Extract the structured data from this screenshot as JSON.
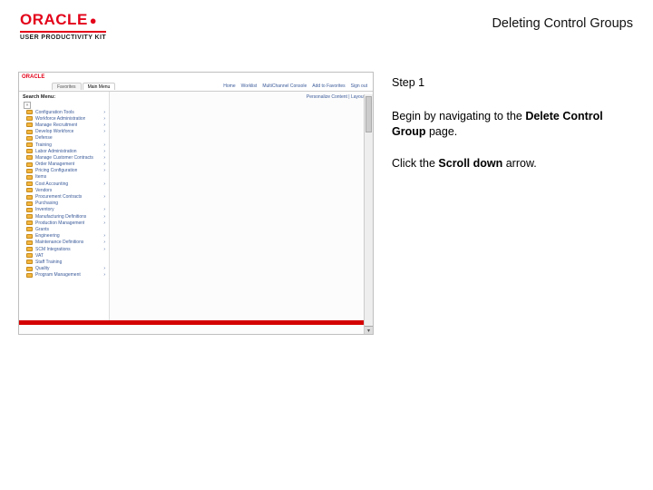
{
  "header": {
    "brand": "ORACLE",
    "subbrand": "USER PRODUCTIVITY KIT",
    "title": "Deleting Control Groups"
  },
  "instructions": {
    "step_label": "Step 1",
    "p1a": "Begin by navigating to the ",
    "p1b": "Delete Control Group",
    "p1c": " page.",
    "p2a": "Click the ",
    "p2b": "Scroll down",
    "p2c": " arrow."
  },
  "shot": {
    "brand": "ORACLE",
    "tabs": [
      "Favorites",
      "Main Menu"
    ],
    "top_links": [
      "Home",
      "Worklist",
      "MultiChannel Console",
      "Add to Favorites",
      "Sign out"
    ],
    "personalize": "Personalize Content | Layout",
    "sidebar_title": "Search Menu:",
    "items": [
      "Configuration Tools",
      "Workforce Administration",
      "Manage Recruitment",
      "Develop Workforce",
      "Defense",
      "Training",
      "Labor Administration",
      "Manage Customer Contracts",
      "Order Management",
      "Pricing Configuration",
      "Items",
      "Cost Accounting",
      "Vendors",
      "Procurement Contracts",
      "Purchasing",
      "Inventory",
      "Manufacturing Definitions",
      "Production Management",
      "Grants",
      "Engineering",
      "Maintenance Definitions",
      "SCM Integrations",
      "VAT",
      "Staff Training",
      "Quality",
      "Program Management"
    ]
  }
}
